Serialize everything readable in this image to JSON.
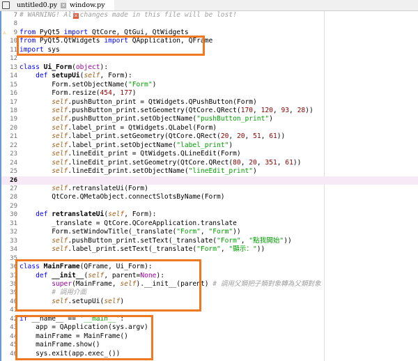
{
  "tabs": [
    {
      "label": "untitled0.py",
      "active": false
    },
    {
      "label": "window.py",
      "active": true
    }
  ],
  "current_line": 26,
  "warning_line": 9,
  "colors": {
    "accent_box": "#f07820",
    "close_active": "#e05a3a",
    "close_inactive": "#b0b0b0"
  },
  "lines": [
    {
      "n": 7,
      "t": [
        [
          "cm",
          "# WARNING! All changes made in this file will be lost!"
        ]
      ]
    },
    {
      "n": 8,
      "t": []
    },
    {
      "n": 9,
      "t": [
        [
          "kw",
          "from"
        ],
        [
          "p",
          " PyQt5 "
        ],
        [
          "kw",
          "import"
        ],
        [
          "p",
          " QtCore, QtGui, QtWidgets"
        ]
      ]
    },
    {
      "n": 10,
      "t": [
        [
          "kw",
          "from"
        ],
        [
          "p",
          " PyQt5.QtWidgets "
        ],
        [
          "kw",
          "import"
        ],
        [
          "p",
          " QApplication, QFrame"
        ]
      ]
    },
    {
      "n": 11,
      "t": [
        [
          "kw",
          "import"
        ],
        [
          "p",
          " sys"
        ]
      ]
    },
    {
      "n": 12,
      "t": []
    },
    {
      "n": 13,
      "t": [
        [
          "kw",
          "class"
        ],
        [
          "p",
          " "
        ],
        [
          "fn",
          "Ui_Form"
        ],
        [
          "p",
          "("
        ],
        [
          "bi",
          "object"
        ],
        [
          "p",
          "):"
        ]
      ]
    },
    {
      "n": 14,
      "t": [
        [
          "p",
          "    "
        ],
        [
          "kw",
          "def"
        ],
        [
          "p",
          " "
        ],
        [
          "fn",
          "setupUi"
        ],
        [
          "p",
          "("
        ],
        [
          "self",
          "self"
        ],
        [
          "p",
          ", Form):"
        ]
      ]
    },
    {
      "n": 15,
      "t": [
        [
          "p",
          "        Form.setObjectName("
        ],
        [
          "str",
          "\"Form\""
        ],
        [
          "p",
          ")"
        ]
      ]
    },
    {
      "n": 16,
      "t": [
        [
          "p",
          "        Form.resize("
        ],
        [
          "num",
          "454"
        ],
        [
          "p",
          ", "
        ],
        [
          "num",
          "177"
        ],
        [
          "p",
          ")"
        ]
      ]
    },
    {
      "n": 17,
      "t": [
        [
          "p",
          "        "
        ],
        [
          "self",
          "self"
        ],
        [
          "p",
          ".pushButton_print = QtWidgets.QPushButton(Form)"
        ]
      ]
    },
    {
      "n": 18,
      "t": [
        [
          "p",
          "        "
        ],
        [
          "self",
          "self"
        ],
        [
          "p",
          ".pushButton_print.setGeometry(QtCore.QRect("
        ],
        [
          "num",
          "170"
        ],
        [
          "p",
          ", "
        ],
        [
          "num",
          "120"
        ],
        [
          "p",
          ", "
        ],
        [
          "num",
          "93"
        ],
        [
          "p",
          ", "
        ],
        [
          "num",
          "28"
        ],
        [
          "p",
          "))"
        ]
      ]
    },
    {
      "n": 19,
      "t": [
        [
          "p",
          "        "
        ],
        [
          "self",
          "self"
        ],
        [
          "p",
          ".pushButton_print.setObjectName("
        ],
        [
          "str",
          "\"pushButton_print\""
        ],
        [
          "p",
          ")"
        ]
      ]
    },
    {
      "n": 20,
      "t": [
        [
          "p",
          "        "
        ],
        [
          "self",
          "self"
        ],
        [
          "p",
          ".label_print = QtWidgets.QLabel(Form)"
        ]
      ]
    },
    {
      "n": 21,
      "t": [
        [
          "p",
          "        "
        ],
        [
          "self",
          "self"
        ],
        [
          "p",
          ".label_print.setGeometry(QtCore.QRect("
        ],
        [
          "num",
          "20"
        ],
        [
          "p",
          ", "
        ],
        [
          "num",
          "20"
        ],
        [
          "p",
          ", "
        ],
        [
          "num",
          "51"
        ],
        [
          "p",
          ", "
        ],
        [
          "num",
          "61"
        ],
        [
          "p",
          "))"
        ]
      ]
    },
    {
      "n": 22,
      "t": [
        [
          "p",
          "        "
        ],
        [
          "self",
          "self"
        ],
        [
          "p",
          ".label_print.setObjectName("
        ],
        [
          "str",
          "\"label_print\""
        ],
        [
          "p",
          ")"
        ]
      ]
    },
    {
      "n": 23,
      "t": [
        [
          "p",
          "        "
        ],
        [
          "self",
          "self"
        ],
        [
          "p",
          ".lineEdit_print = QtWidgets.QLineEdit(Form)"
        ]
      ]
    },
    {
      "n": 24,
      "t": [
        [
          "p",
          "        "
        ],
        [
          "self",
          "self"
        ],
        [
          "p",
          ".lineEdit_print.setGeometry(QtCore.QRect("
        ],
        [
          "num",
          "80"
        ],
        [
          "p",
          ", "
        ],
        [
          "num",
          "20"
        ],
        [
          "p",
          ", "
        ],
        [
          "num",
          "351"
        ],
        [
          "p",
          ", "
        ],
        [
          "num",
          "61"
        ],
        [
          "p",
          "))"
        ]
      ]
    },
    {
      "n": 25,
      "t": [
        [
          "p",
          "        "
        ],
        [
          "self",
          "self"
        ],
        [
          "p",
          ".lineEdit_print.setObjectName("
        ],
        [
          "str",
          "\"lineEdit_print\""
        ],
        [
          "p",
          ")"
        ]
      ]
    },
    {
      "n": 26,
      "t": []
    },
    {
      "n": 27,
      "t": [
        [
          "p",
          "        "
        ],
        [
          "self",
          "self"
        ],
        [
          "p",
          ".retranslateUi(Form)"
        ]
      ]
    },
    {
      "n": 28,
      "t": [
        [
          "p",
          "        QtCore.QMetaObject.connectSlotsByName(Form)"
        ]
      ]
    },
    {
      "n": 29,
      "t": []
    },
    {
      "n": 30,
      "t": [
        [
          "p",
          "    "
        ],
        [
          "kw",
          "def"
        ],
        [
          "p",
          " "
        ],
        [
          "fn",
          "retranslateUi"
        ],
        [
          "p",
          "("
        ],
        [
          "self",
          "self"
        ],
        [
          "p",
          ", Form):"
        ]
      ]
    },
    {
      "n": 31,
      "t": [
        [
          "p",
          "        _translate = QtCore.QCoreApplication.translate"
        ]
      ]
    },
    {
      "n": 32,
      "t": [
        [
          "p",
          "        Form.setWindowTitle(_translate("
        ],
        [
          "str",
          "\"Form\""
        ],
        [
          "p",
          ", "
        ],
        [
          "str",
          "\"Form\""
        ],
        [
          "p",
          "))"
        ]
      ]
    },
    {
      "n": 33,
      "t": [
        [
          "p",
          "        "
        ],
        [
          "self",
          "self"
        ],
        [
          "p",
          ".pushButton_print.setText(_translate("
        ],
        [
          "str",
          "\"Form\""
        ],
        [
          "p",
          ", "
        ],
        [
          "str",
          "\"點我開始\""
        ],
        [
          "p",
          "))"
        ]
      ]
    },
    {
      "n": 34,
      "t": [
        [
          "p",
          "        "
        ],
        [
          "self",
          "self"
        ],
        [
          "p",
          ".label_print.setText(_translate("
        ],
        [
          "str",
          "\"Form\""
        ],
        [
          "p",
          ", "
        ],
        [
          "str",
          "\"顯示：\""
        ],
        [
          "p",
          "))"
        ]
      ]
    },
    {
      "n": 35,
      "t": []
    },
    {
      "n": 36,
      "t": [
        [
          "kw",
          "class"
        ],
        [
          "p",
          " "
        ],
        [
          "fn",
          "MainFrame"
        ],
        [
          "p",
          "(QFrame, Ui_Form):"
        ]
      ]
    },
    {
      "n": 37,
      "t": [
        [
          "p",
          "    "
        ],
        [
          "kw",
          "def"
        ],
        [
          "p",
          " "
        ],
        [
          "fn",
          "__init__"
        ],
        [
          "p",
          "("
        ],
        [
          "self",
          "self"
        ],
        [
          "p",
          ", parent="
        ],
        [
          "bi",
          "None"
        ],
        [
          "p",
          "):"
        ]
      ]
    },
    {
      "n": 38,
      "t": [
        [
          "p",
          "        "
        ],
        [
          "bi",
          "super"
        ],
        [
          "p",
          "(MainFrame, "
        ],
        [
          "self",
          "self"
        ],
        [
          "p",
          ").__init__(parent) "
        ],
        [
          "cm",
          "# 調用父類把子類對象轉為父類對象"
        ]
      ]
    },
    {
      "n": 39,
      "t": [
        [
          "p",
          "        "
        ],
        [
          "cm",
          "# 調用介面"
        ]
      ]
    },
    {
      "n": 40,
      "t": [
        [
          "p",
          "        "
        ],
        [
          "self",
          "self"
        ],
        [
          "p",
          ".setupUi("
        ],
        [
          "self",
          "self"
        ],
        [
          "p",
          ")"
        ]
      ]
    },
    {
      "n": 41,
      "t": []
    },
    {
      "n": 42,
      "t": [
        [
          "kw",
          "if"
        ],
        [
          "p",
          " __name__ == "
        ],
        [
          "str",
          "'__main__'"
        ],
        [
          "p",
          ":"
        ]
      ]
    },
    {
      "n": 43,
      "t": [
        [
          "p",
          "    app = QApplication(sys.argv)"
        ]
      ]
    },
    {
      "n": 44,
      "t": [
        [
          "p",
          "    mainFrame = MainFrame()"
        ]
      ]
    },
    {
      "n": 45,
      "t": [
        [
          "p",
          "    mainFrame.show()"
        ]
      ]
    },
    {
      "n": 46,
      "t": [
        [
          "p",
          "    sys.exit(app.exec_())"
        ]
      ]
    }
  ]
}
